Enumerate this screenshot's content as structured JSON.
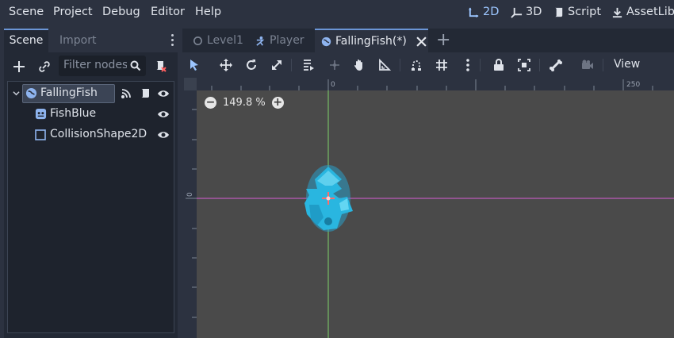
{
  "menubar": {
    "items": [
      "Scene",
      "Project",
      "Debug",
      "Editor",
      "Help"
    ],
    "modes": [
      "2D",
      "3D",
      "Script",
      "AssetLib"
    ],
    "active_mode": "2D"
  },
  "scene_dock": {
    "tabs": [
      "Scene",
      "Import"
    ],
    "active_tab": "Scene",
    "filter_placeholder": "Filter nodes",
    "tree": [
      {
        "label": "FallingFish",
        "icon": "node2d-icon",
        "selected": true,
        "expanded": true,
        "depth": 0
      },
      {
        "label": "FishBlue",
        "icon": "sprite-icon",
        "selected": false,
        "depth": 1
      },
      {
        "label": "CollisionShape2D",
        "icon": "collision-shape-icon",
        "selected": false,
        "depth": 1
      }
    ]
  },
  "editor_tabs": {
    "tabs": [
      {
        "label": "Level1",
        "icon": "circle-icon",
        "active": false
      },
      {
        "label": "Player",
        "icon": "player-icon",
        "active": false
      },
      {
        "label": "FallingFish(*)",
        "icon": "globe-icon",
        "active": true
      }
    ],
    "add_label": "+"
  },
  "viewport": {
    "view_label": "View",
    "zoom_text": "149.8 %",
    "ruler_labels": {
      "h_origin": "0",
      "h_250": "250",
      "v_origin": "0"
    }
  },
  "colors": {
    "accent": "#6b95d6",
    "x_axis": "#d85ed6",
    "y_axis": "#7ed36a",
    "fish": "#29b6e0"
  }
}
